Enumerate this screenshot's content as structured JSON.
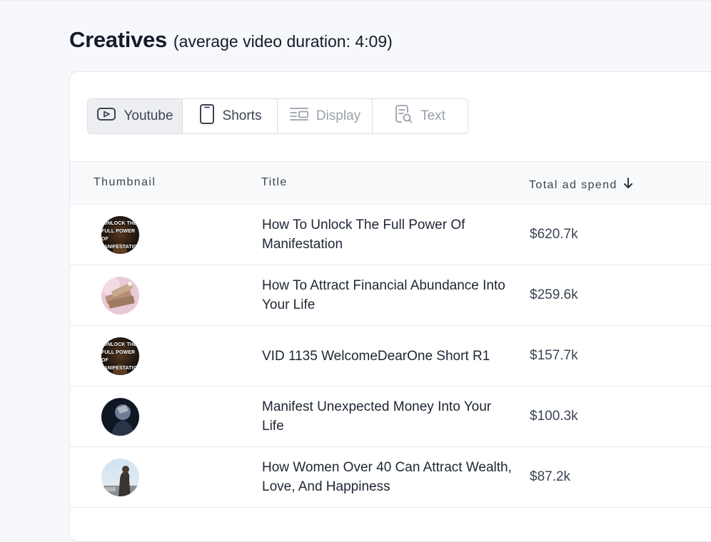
{
  "header": {
    "title": "Creatives",
    "subtitle": "(average video duration: 4:09)"
  },
  "tabs": [
    {
      "label": "Youtube",
      "icon": "play-icon",
      "state": "active"
    },
    {
      "label": "Shorts",
      "icon": "phone-icon",
      "state": "enabled"
    },
    {
      "label": "Display",
      "icon": "display-icon",
      "state": "disabled"
    },
    {
      "label": "Text",
      "icon": "text-search-icon",
      "state": "disabled"
    }
  ],
  "table": {
    "columns": {
      "thumbnail": "Thumbnail",
      "title": "Title",
      "total_ad_spend": "Total ad spend"
    },
    "sort": {
      "column": "total_ad_spend",
      "direction": "descending",
      "icon": "arrow-down-icon"
    },
    "rows": [
      {
        "thumbnail_lines": [
          "UNLOCK THE",
          "FULL POWER OF",
          "MANIFESTATION"
        ],
        "thumbnail_style": "text-dark",
        "title": "How To Unlock The Full Power Of Manifestation",
        "spend": "$620.7k"
      },
      {
        "thumbnail_lines": [],
        "thumbnail_style": "money-pink",
        "title": "How To Attract Financial Abundance Into Your Life",
        "spend": "$259.6k"
      },
      {
        "thumbnail_lines": [
          "UNLOCK THE",
          "FULL POWER OF",
          "MANIFESTATION"
        ],
        "thumbnail_style": "text-dark",
        "title": "VID 1135 WelcomeDearOne Short R1",
        "spend": "$157.7k"
      },
      {
        "thumbnail_lines": [],
        "thumbnail_style": "dark-portrait",
        "title": "Manifest Unexpected Money Into Your Life",
        "spend": "$100.3k"
      },
      {
        "thumbnail_lines": [],
        "thumbnail_style": "sky-figure",
        "title": "How Women Over 40 Can Attract Wealth, Love, And Happiness",
        "spend": "$87.2k"
      }
    ]
  },
  "colors": {
    "page_bg": "#f7f8fb",
    "active_tab_bg": "#eceef1",
    "text_primary": "#1e2633",
    "text_muted": "#9aa1ab"
  }
}
